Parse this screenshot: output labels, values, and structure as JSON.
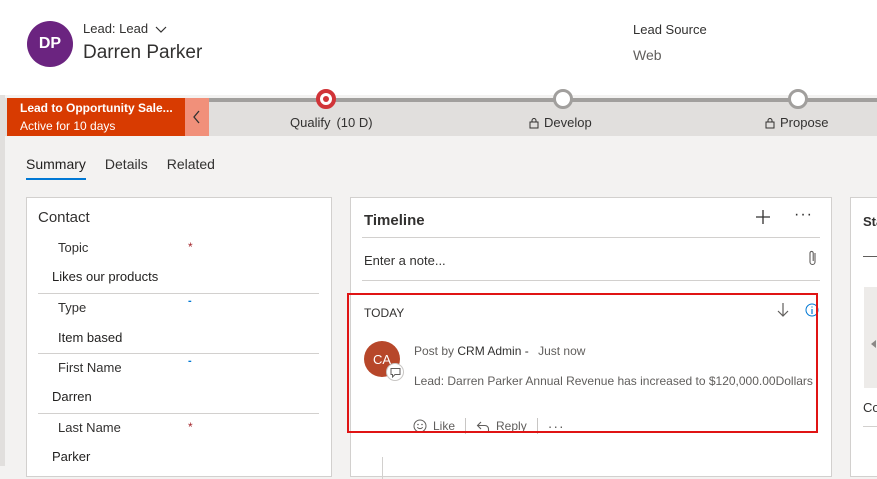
{
  "header": {
    "avatar_initials": "DP",
    "entity_type": "Lead: Lead",
    "record_name": "Darren Parker",
    "lead_source_label": "Lead Source",
    "lead_source_value": "Web"
  },
  "process": {
    "name": "Lead to Opportunity Sale...",
    "duration": "Active for 10 days",
    "stages": [
      {
        "name": "Qualify",
        "duration": "(10 D)",
        "state": "active"
      },
      {
        "name": "Develop",
        "state": "locked"
      },
      {
        "name": "Propose",
        "state": "locked"
      }
    ],
    "accent_color": "#d83b01"
  },
  "tabs": [
    {
      "label": "Summary",
      "selected": true
    },
    {
      "label": "Details",
      "selected": false
    },
    {
      "label": "Related",
      "selected": false
    }
  ],
  "contact": {
    "title": "Contact",
    "required_marker": "*",
    "recommended_marker": "-",
    "fields": [
      {
        "label": "Topic",
        "value": "Likes our products",
        "marker": "*"
      },
      {
        "label": "Type",
        "value": "Item based",
        "marker": "-"
      },
      {
        "label": "First Name",
        "value": "Darren",
        "marker": "-"
      },
      {
        "label": "Last Name",
        "value": "Parker",
        "marker": "*"
      }
    ]
  },
  "timeline": {
    "title": "Timeline",
    "note_placeholder": "Enter a note...",
    "group_label": "TODAY",
    "post": {
      "avatar_initials": "CA",
      "prefix": "Post by",
      "author": "CRM Admin -",
      "time": "Just now",
      "body": "Lead: Darren Parker Annual Revenue has increased to $120,000.00Dollars",
      "actions": {
        "like": "Like",
        "reply": "Reply",
        "more": "···"
      }
    },
    "more": "···"
  },
  "right_panel": {
    "title": "Sta",
    "title2": "Co"
  }
}
